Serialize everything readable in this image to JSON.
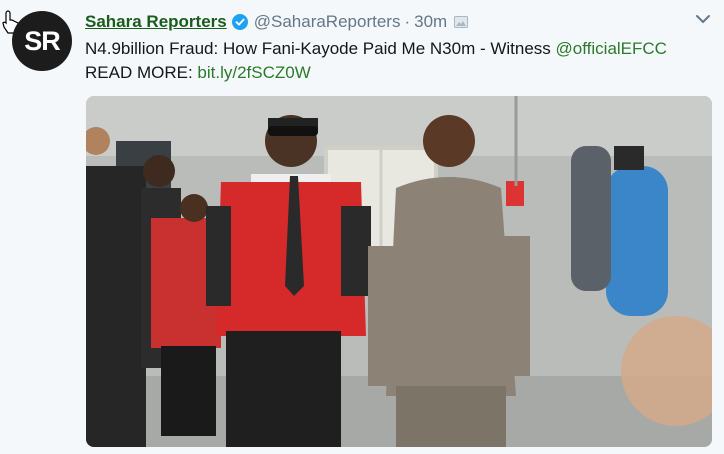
{
  "tweet": {
    "author_name": "Sahara Reporters",
    "avatar_text": "SR",
    "handle": "@SaharaReporters",
    "separator": "·",
    "time": "30m",
    "text": "N4.9billion Fraud: How Fani-Kayode Paid Me N30m - Witness",
    "mention": "@officialEFCC",
    "read_more_label": "READ MORE:",
    "link": "bit.ly/2fSCZ0W"
  },
  "colors": {
    "author_name": "#1a5c1a",
    "link": "#2b7a2b",
    "verified": "#1da1f2",
    "background": "#f5f8fa"
  },
  "icons": {
    "verified": "verified-badge-icon",
    "media": "image-icon",
    "menu": "chevron-down-icon",
    "cursor": "hand-pointer-icon"
  }
}
